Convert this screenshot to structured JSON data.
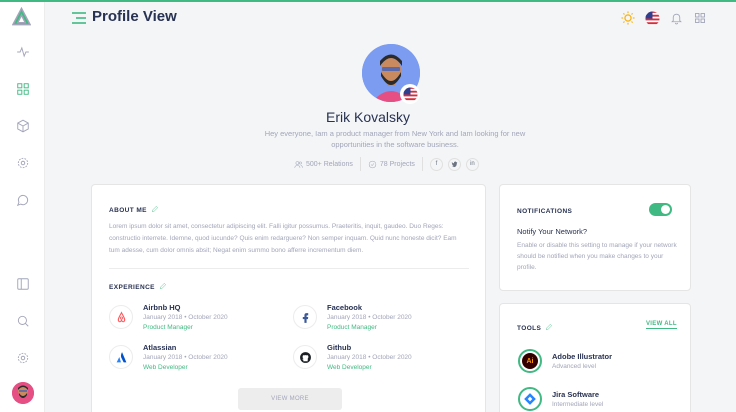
{
  "header": {
    "title": "Profile View"
  },
  "profile": {
    "name": "Erik Kovalsky",
    "bio": "Hey everyone, Iam a product manager from New York and Iam looking for new opportunities in the software business.",
    "relations": "500+ Relations",
    "projects": "78 Projects",
    "social": {
      "facebook": "f",
      "twitter": "t",
      "linkedin": "in"
    }
  },
  "about": {
    "title": "ABOUT ME",
    "text": "Lorem ipsum dolor sit amet, consectetur adipiscing elit. Falli igitur possumus. Praeteritis, inquit, gaudeo. Duo Reges: constructio interrete. Idemne, quod iucunde? Quis enim redarguere? Non semper inquam. Quid nunc honeste dicit? Eam tum adesse, cum dolor omnis absit; Negat enim summo bono afferre incrementum diem."
  },
  "experience": {
    "title": "EXPERIENCE",
    "items": [
      {
        "company": "Airbnb HQ",
        "dates": "January 2018  •  October 2020",
        "role": "Product Manager",
        "icon": "airbnb-icon"
      },
      {
        "company": "Facebook",
        "dates": "January 2018  •  October 2020",
        "role": "Product Manager",
        "icon": "facebook-icon"
      },
      {
        "company": "Atlassian",
        "dates": "January 2018  •  October 2020",
        "role": "Web Developer",
        "icon": "atlassian-icon"
      },
      {
        "company": "Github",
        "dates": "January 2018  •  October 2020",
        "role": "Web Developer",
        "icon": "github-icon"
      }
    ],
    "view_more": "VIEW MORE"
  },
  "notifications": {
    "title": "NOTIFICATIONS",
    "enabled": true,
    "label": "Notify Your Network?",
    "text": "Enable or disable this setting to manage if your network should be notified when you make changes to your profile."
  },
  "tools": {
    "title": "TOOLS",
    "view_all": "VIEW ALL",
    "items": [
      {
        "name": "Adobe Illustrator",
        "level": "Advanced level",
        "icon": "illustrator-icon",
        "glyph": "Ai"
      },
      {
        "name": "Jira Software",
        "level": "Intermediate level",
        "icon": "jira-icon"
      }
    ]
  },
  "colors": {
    "accent": "#41b983",
    "text": "#283252",
    "muted": "#a2a5b9"
  }
}
